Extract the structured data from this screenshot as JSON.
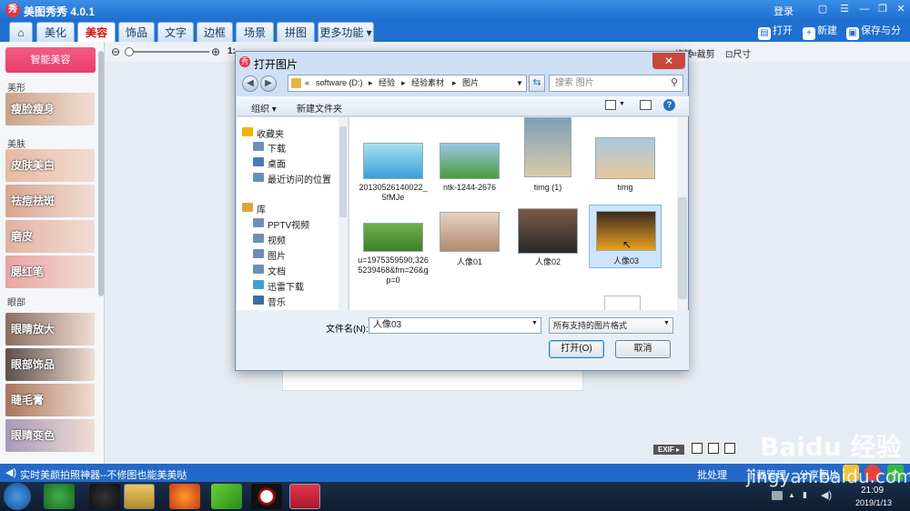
{
  "app": {
    "title": "美图秀秀 4.0.1",
    "logo_glyph": "秀",
    "login": "登录"
  },
  "window_controls": {
    "minimize": "—",
    "restore": "❐",
    "close": "✕"
  },
  "tabs": [
    {
      "label": "⌂"
    },
    {
      "label": "美化"
    },
    {
      "label": "美容"
    },
    {
      "label": "饰品"
    },
    {
      "label": "文字"
    },
    {
      "label": "边框"
    },
    {
      "label": "场景"
    },
    {
      "label": "拼图"
    },
    {
      "label": "更多功能 ▾"
    }
  ],
  "top_actions": {
    "open": "打开",
    "new": "新建",
    "save": "保存与分享"
  },
  "sidebar": {
    "smart_button": "智能美容",
    "sections": [
      {
        "head": "美形"
      },
      {
        "head": "美肤"
      },
      {
        "head": "眼部"
      }
    ],
    "items": [
      {
        "label": "瘦脸瘦身",
        "color": "#c9a38a"
      },
      {
        "label": "皮肤美白",
        "color": "#e7b9a3"
      },
      {
        "label": "祛痘祛斑",
        "color": "#d8a690"
      },
      {
        "label": "磨皮",
        "color": "#e2b2a2"
      },
      {
        "label": "腮红笔",
        "color": "#e9a3a3"
      },
      {
        "label": "眼睛放大",
        "color": "#8a6e60"
      },
      {
        "label": "眼部饰品",
        "color": "#5e4f49"
      },
      {
        "label": "睫毛膏",
        "color": "#a8765a"
      },
      {
        "label": "眼睛变色",
        "color": "#a69ab8"
      }
    ]
  },
  "toolbar": {
    "zoom_prefix": "1:",
    "rotate": "旋转",
    "crop": "裁剪",
    "size": "尺寸",
    "exif": "EXIF ▸"
  },
  "dialog": {
    "title": "打开图片",
    "address": [
      "«",
      "software (D:)",
      "▸",
      "经验",
      "▸",
      "经验素材",
      "▸",
      "图片"
    ],
    "search_placeholder": "搜索 图片",
    "organize": "组织 ▾",
    "new_folder": "新建文件夹",
    "nav": [
      {
        "label": "收藏夹",
        "icon": "star",
        "color": "#f0b400"
      },
      {
        "label": "下载",
        "icon": "download-folder",
        "color": "#6b8fb8"
      },
      {
        "label": "桌面",
        "icon": "desktop",
        "color": "#4a7ab0"
      },
      {
        "label": "最近访问的位置",
        "icon": "recent-places",
        "color": "#6b8fb8"
      },
      {
        "label": "库",
        "icon": "library",
        "color": "#e0a23a"
      },
      {
        "label": "PPTV视频",
        "icon": "video-folder",
        "color": "#6b8fb8"
      },
      {
        "label": "视频",
        "icon": "video-library",
        "color": "#6b8fb8"
      },
      {
        "label": "图片",
        "icon": "pictures-library",
        "color": "#6b8fb8"
      },
      {
        "label": "文档",
        "icon": "documents-library",
        "color": "#6b8fb8"
      },
      {
        "label": "迅雷下载",
        "icon": "thunder-folder",
        "color": "#4a9ed8"
      },
      {
        "label": "音乐",
        "icon": "music-library",
        "color": "#3a6ea5"
      }
    ],
    "files": [
      {
        "name": "20130526140022_5fMJe",
        "color1": "#3aa0d8",
        "color2": "#a8e0f0"
      },
      {
        "name": "ntk-1244-2676",
        "color1": "#4d9a3a",
        "color2": "#9ac6e8"
      },
      {
        "name": "timg (1)",
        "color1": "#d9c9a8",
        "color2": "#7fa0b8"
      },
      {
        "name": "timg",
        "color1": "#e6c79a",
        "color2": "#a8c8e0"
      },
      {
        "name": "u=1975359590,3265239468&fm=26&gp=0",
        "color1": "#3f7f2e",
        "color2": "#6fb04a"
      },
      {
        "name": "人像01",
        "color1": "#b08a70",
        "color2": "#e6d2c0"
      },
      {
        "name": "人像02",
        "color1": "#2a2a2a",
        "color2": "#7a5a48"
      },
      {
        "name": "人像03",
        "color1": "#e8a020",
        "color2": "#3a2a20",
        "selected": true
      }
    ],
    "filename_label": "文件名(N):",
    "filename_value": "人像03",
    "filetype": "所有支持的图片格式",
    "open_button": "打开(O)",
    "cancel_button": "取消"
  },
  "statusbar": {
    "tip": "实时美颜拍照神器--不修图也能美美哒",
    "batch": "批处理",
    "download": "下载管理",
    "share": "分享图片"
  },
  "taskbar": {
    "time": "21:09",
    "date": "2019/1/13"
  },
  "watermark": {
    "brand": "Baidu 经验",
    "url": "jingyan.baidu.com"
  }
}
